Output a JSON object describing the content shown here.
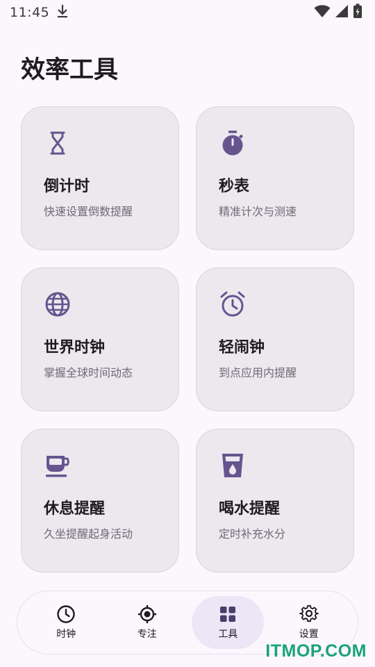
{
  "status_bar": {
    "time": "11:45",
    "download_icon": "download-icon",
    "wifi_icon": "wifi-icon",
    "signal_icon": "signal-icon",
    "battery_icon": "battery-charging-icon"
  },
  "page": {
    "title": "效率工具"
  },
  "cards": [
    {
      "title": "倒计时",
      "subtitle": "快速设置倒数提醒",
      "icon": "hourglass-icon"
    },
    {
      "title": "秒表",
      "subtitle": "精准计次与测速",
      "icon": "stopwatch-icon"
    },
    {
      "title": "世界时钟",
      "subtitle": "掌握全球时间动态",
      "icon": "globe-icon"
    },
    {
      "title": "轻闹钟",
      "subtitle": "到点应用内提醒",
      "icon": "alarm-clock-icon"
    },
    {
      "title": "休息提醒",
      "subtitle": "久坐提醒起身活动",
      "icon": "coffee-cup-icon"
    },
    {
      "title": "喝水提醒",
      "subtitle": "定时补充水分",
      "icon": "water-glass-icon"
    }
  ],
  "bottom_nav": {
    "items": [
      {
        "label": "时钟",
        "icon": "clock-icon",
        "active": false
      },
      {
        "label": "专注",
        "icon": "focus-target-icon",
        "active": false
      },
      {
        "label": "工具",
        "icon": "grid-apps-icon",
        "active": true
      },
      {
        "label": "设置",
        "icon": "gear-icon",
        "active": false
      }
    ]
  },
  "watermark": "ITMOP.COM",
  "colors": {
    "accent": "#65558f",
    "card_bg": "#ece8ee",
    "page_bg": "#fbf7fd",
    "watermark": "#1aa37a"
  }
}
